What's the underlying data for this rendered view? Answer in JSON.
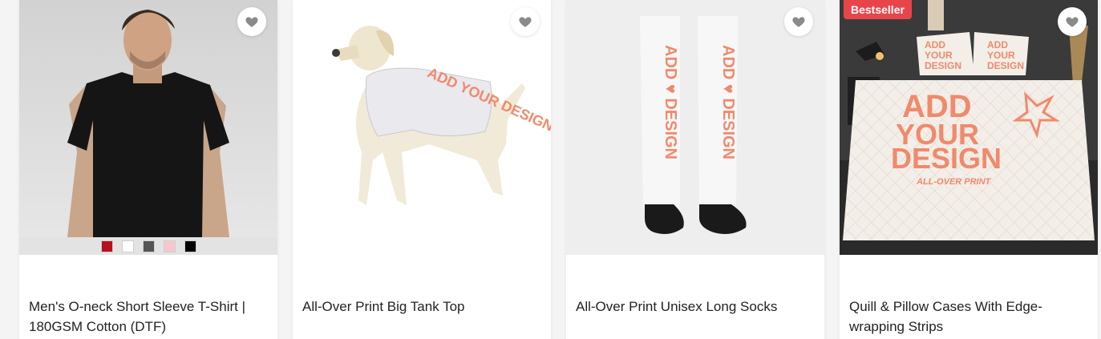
{
  "products": [
    {
      "title": "Men's O-neck Short Sleeve T-Shirt | 180GSM Cotton (DTF)",
      "swatches": [
        "#b5121b",
        "#ffffff",
        "#555555",
        "#f7c6cf",
        "#000000"
      ]
    },
    {
      "title": "All-Over Print Big Tank Top",
      "print_text": "ADD YOUR DESIGN"
    },
    {
      "title": "All-Over Print Unisex Long Socks",
      "print_text": "ADD ♥ DESIGN"
    },
    {
      "title": "Quill & Pillow Cases With Edge-wrapping Strips",
      "badge": "Bestseller",
      "print_text_line1": "ADD",
      "print_text_line2": "YOUR",
      "print_text_line3": "DESIGN",
      "print_subtext": "ALL-OVER PRINT"
    }
  ],
  "icons": {
    "favorite": "heart-icon"
  },
  "colors": {
    "accent_print": "#f08a6c",
    "badge_bg": "#e8454b",
    "heart": "#8a8a8a"
  }
}
